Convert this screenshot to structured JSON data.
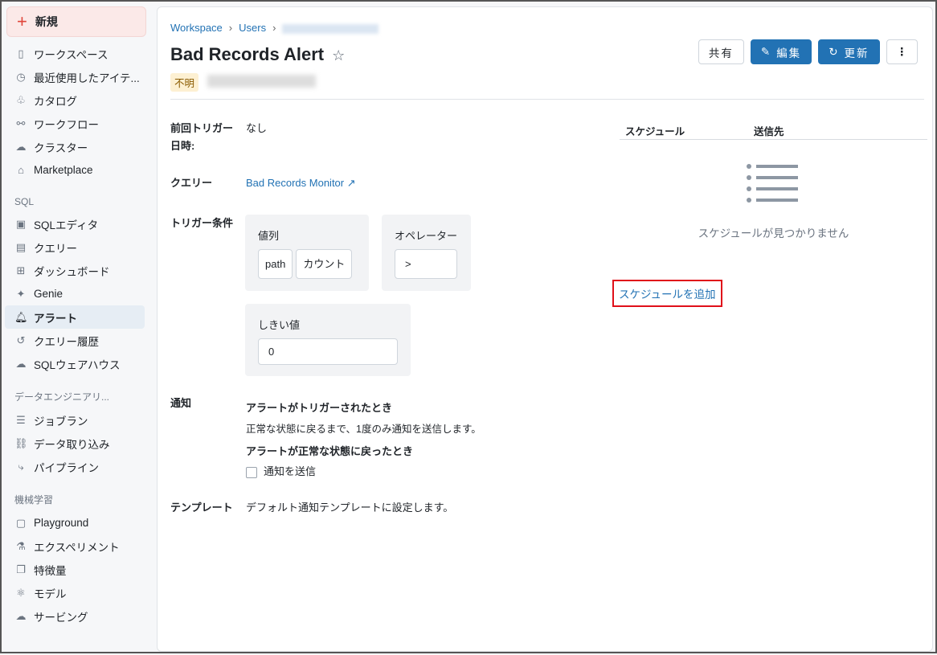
{
  "sidebar": {
    "new": "新規",
    "items": [
      "ワークスペース",
      "最近使用したアイテ...",
      "カタログ",
      "ワークフロー",
      "クラスター",
      "Marketplace"
    ],
    "sql_section": "SQL",
    "sql_items": [
      "SQLエディタ",
      "クエリー",
      "ダッシュボード",
      "Genie",
      "アラート",
      "クエリー履歴",
      "SQLウェアハウス"
    ],
    "de_section": "データエンジニアリ...",
    "de_items": [
      "ジョブラン",
      "データ取り込み",
      "パイプライン"
    ],
    "ml_section": "機械学習",
    "ml_items": [
      "Playground",
      "エクスペリメント",
      "特徴量",
      "モデル",
      "サービング"
    ]
  },
  "breadcrumb": [
    "Workspace",
    "Users"
  ],
  "title": "Bad Records Alert",
  "status": "不明",
  "buttons": {
    "share": "共有",
    "edit": "編集",
    "refresh": "更新"
  },
  "fields": {
    "last_trigger_label": "前回トリガー日時:",
    "last_trigger_value": "なし",
    "query_label": "クエリー",
    "query_value": "Bad Records Monitor",
    "trigger_label": "トリガー条件",
    "value_col_label": "値列",
    "value_col": [
      "path",
      "カウント"
    ],
    "operator_label": "オペレーター",
    "operator": ">",
    "threshold_label": "しきい値",
    "threshold": "0",
    "notify_label": "通知",
    "notify_h1": "アラートがトリガーされたとき",
    "notify_t1": "正常な状態に戻るまで、1度のみ通知を送信します。",
    "notify_h2": "アラートが正常な状態に戻ったとき",
    "notify_cb": "通知を送信",
    "template_label": "テンプレート",
    "template_value": "デフォルト通知テンプレートに設定します。"
  },
  "schedule": {
    "col1": "スケジュール",
    "col2": "送信先",
    "empty": "スケジュールが見つかりません",
    "add": "スケジュールを追加"
  }
}
